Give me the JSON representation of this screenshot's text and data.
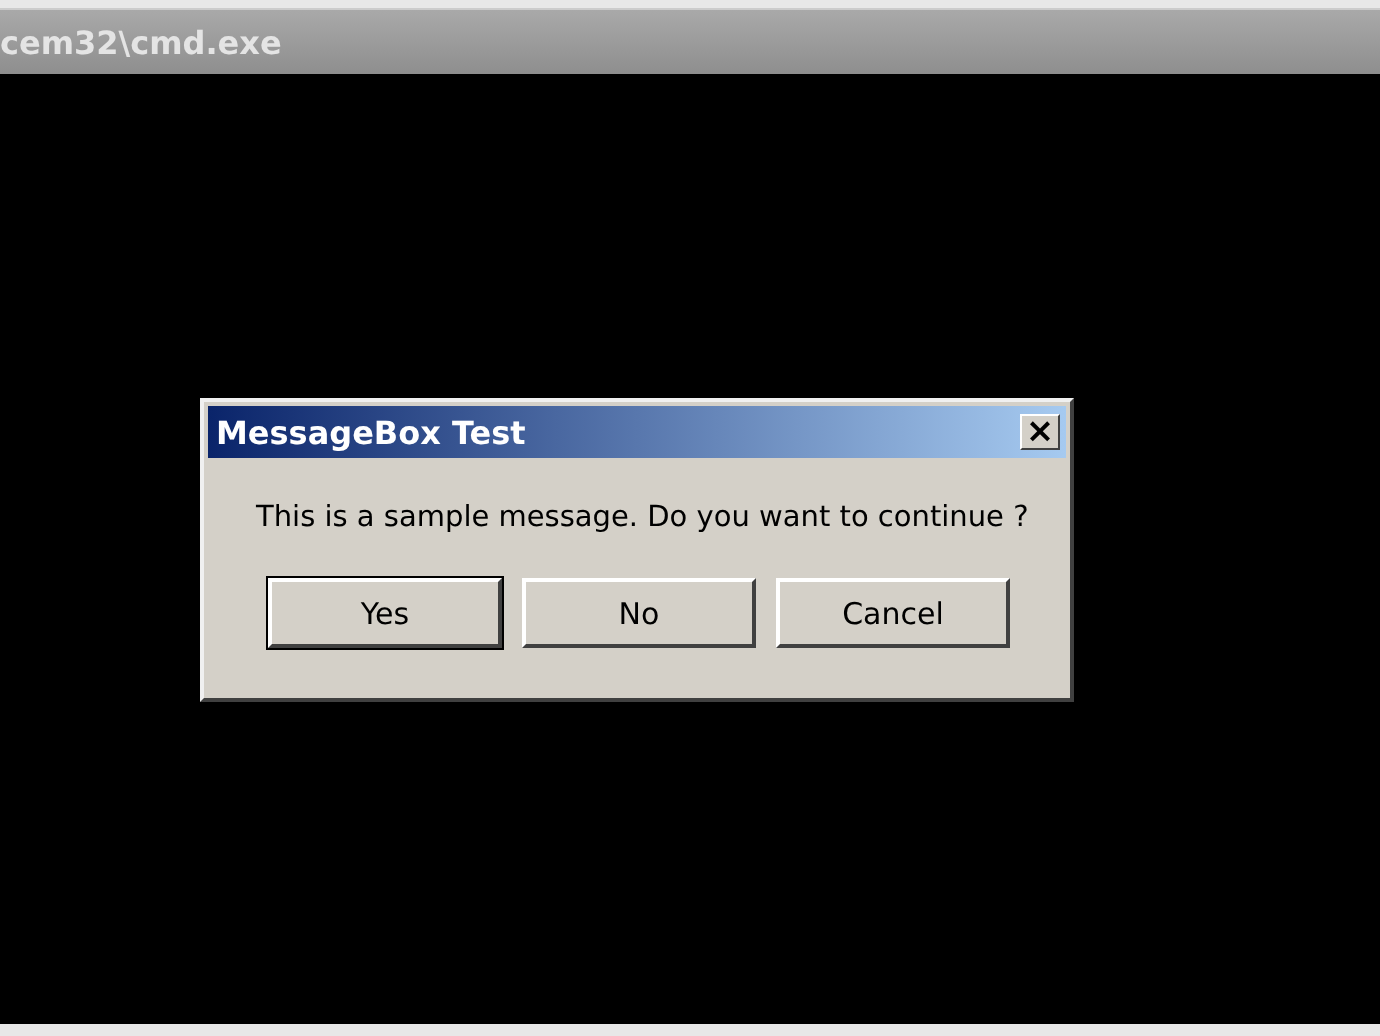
{
  "console_window": {
    "title": "cem32\\cmd.exe"
  },
  "dialog": {
    "title": "MessageBox Test",
    "close": "×",
    "message": "This is a sample message. Do you want to continue ?",
    "buttons": [
      {
        "label": "Yes",
        "selected": true
      },
      {
        "label": "No",
        "selected": false
      },
      {
        "label": "Cancel",
        "selected": false
      }
    ]
  }
}
